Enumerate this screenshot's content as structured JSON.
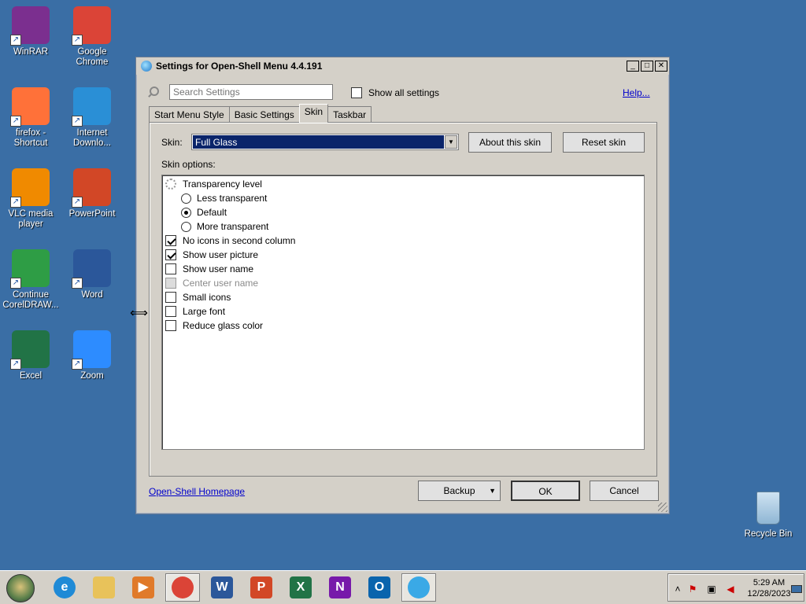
{
  "desktop": {
    "icons": [
      {
        "label": "WinRAR",
        "color": "#7b2f8f"
      },
      {
        "label": "Google Chrome",
        "color": "#db4437"
      },
      {
        "label": "firefox - Shortcut",
        "color": "#ff7139"
      },
      {
        "label": "Internet Downlo...",
        "color": "#2a8fd6"
      },
      {
        "label": "VLC media player",
        "color": "#f08a00"
      },
      {
        "label": "PowerPoint",
        "color": "#d24726"
      },
      {
        "label": "Continue CorelDRAW...",
        "color": "#2e9d45"
      },
      {
        "label": "Word",
        "color": "#2b579a"
      },
      {
        "label": "Excel",
        "color": "#217346"
      },
      {
        "label": "Zoom",
        "color": "#2d8cff"
      }
    ],
    "recycle_bin": "Recycle Bin"
  },
  "window": {
    "title": "Settings for Open-Shell Menu 4.4.191",
    "search_placeholder": "Search Settings",
    "show_all_label": "Show all settings",
    "help_link": "Help...",
    "tabs": [
      "Start Menu Style",
      "Basic Settings",
      "Skin",
      "Taskbar"
    ],
    "active_tab": "Skin",
    "skin_label": "Skin:",
    "skin_value": "Full Glass",
    "about_skin_button": "About this skin",
    "reset_skin_button": "Reset skin",
    "skin_options_label": "Skin options:",
    "options": [
      {
        "label": "Transparency level",
        "type": "group"
      },
      {
        "label": "Less transparent",
        "type": "radio",
        "checked": false
      },
      {
        "label": "Default",
        "type": "radio",
        "checked": true
      },
      {
        "label": "More transparent",
        "type": "radio",
        "checked": false
      },
      {
        "label": "No icons in second column",
        "type": "checkbox",
        "checked": true
      },
      {
        "label": "Show user picture",
        "type": "checkbox",
        "checked": true
      },
      {
        "label": "Show user name",
        "type": "checkbox",
        "checked": false
      },
      {
        "label": "Center user name",
        "type": "checkbox",
        "checked": false,
        "disabled": true
      },
      {
        "label": "Small icons",
        "type": "checkbox",
        "checked": false
      },
      {
        "label": "Large font",
        "type": "checkbox",
        "checked": false
      },
      {
        "label": "Reduce glass color",
        "type": "checkbox",
        "checked": false
      }
    ],
    "homepage_link": "Open-Shell Homepage",
    "backup_button": "Backup",
    "ok_button": "OK",
    "cancel_button": "Cancel"
  },
  "taskbar": {
    "apps": [
      {
        "name": "edge",
        "letter": "e",
        "color": "#1f8ad6"
      },
      {
        "name": "file-explorer",
        "letter": "",
        "color": "#e8c25a"
      },
      {
        "name": "media-player",
        "letter": "▶",
        "color": "#e07a2a"
      },
      {
        "name": "chrome",
        "letter": "",
        "color": "#db4437",
        "active": true
      },
      {
        "name": "word",
        "letter": "W",
        "color": "#2b579a"
      },
      {
        "name": "powerpoint",
        "letter": "P",
        "color": "#d24726"
      },
      {
        "name": "excel",
        "letter": "X",
        "color": "#217346"
      },
      {
        "name": "onenote",
        "letter": "N",
        "color": "#7719aa"
      },
      {
        "name": "outlook",
        "letter": "O",
        "color": "#0a64ad"
      },
      {
        "name": "open-shell",
        "letter": "",
        "color": "#3aa9e6",
        "active": true
      }
    ],
    "time": "5:29 AM",
    "date": "12/28/2023"
  }
}
